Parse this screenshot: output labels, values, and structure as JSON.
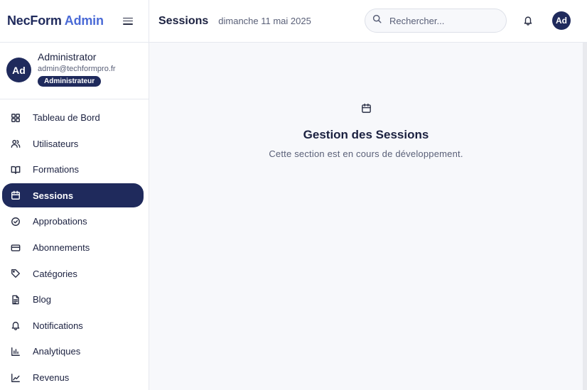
{
  "brand": {
    "name": "NecForm",
    "accent": "Admin"
  },
  "user": {
    "initials": "Ad",
    "name": "Administrator",
    "email": "admin@techformpro.fr",
    "role": "Administrateur"
  },
  "nav": {
    "items": [
      {
        "label": "Tableau de Bord",
        "icon": "dashboard-grid-icon"
      },
      {
        "label": "Utilisateurs",
        "icon": "users-icon"
      },
      {
        "label": "Formations",
        "icon": "book-open-icon"
      },
      {
        "label": "Sessions",
        "icon": "calendar-icon",
        "active": true
      },
      {
        "label": "Approbations",
        "icon": "check-circle-icon"
      },
      {
        "label": "Abonnements",
        "icon": "credit-card-icon"
      },
      {
        "label": "Catégories",
        "icon": "tag-icon"
      },
      {
        "label": "Blog",
        "icon": "file-text-icon"
      },
      {
        "label": "Notifications",
        "icon": "bell-icon"
      },
      {
        "label": "Analytiques",
        "icon": "bar-chart-icon"
      },
      {
        "label": "Revenus",
        "icon": "line-chart-icon"
      }
    ]
  },
  "header": {
    "title": "Sessions",
    "date": "dimanche 11 mai 2025",
    "search_placeholder": "Rechercher...",
    "avatar_initials": "Ad"
  },
  "main": {
    "icon": "calendar-icon",
    "title": "Gestion des Sessions",
    "subtitle": "Cette section est en cours de développement."
  },
  "colors": {
    "primary": "#1f2a5c",
    "accent": "#4a6ad6",
    "background": "#f7f8fb",
    "muted_text": "#5a6078"
  }
}
